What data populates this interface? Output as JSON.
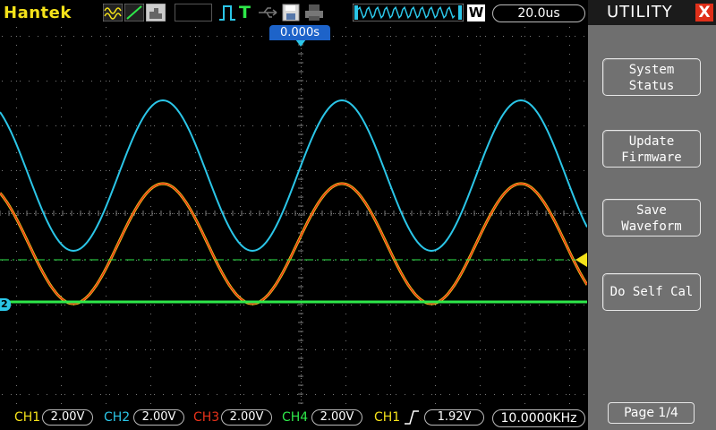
{
  "brand": "Hantek",
  "status": {
    "run_icon": "T",
    "timebase": "20.0us",
    "window_mark": "W"
  },
  "trigger": {
    "delay": "0.000s",
    "channel_marker": "2"
  },
  "menu": {
    "title": "UTILITY",
    "close_icon": "X",
    "buttons": [
      "System Status",
      "Update Firmware",
      "Save Waveform",
      "Do Self Cal"
    ],
    "button_lines": [
      [
        "System",
        "Status"
      ],
      [
        "Update",
        "Firmware"
      ],
      [
        "Save",
        "Waveform"
      ],
      [
        "Do Self Cal"
      ]
    ],
    "page": "Page 1/4"
  },
  "channels": [
    {
      "label": "CH1",
      "scale": "2.00V",
      "color": "#f5e21a"
    },
    {
      "label": "CH2",
      "scale": "2.00V",
      "color": "#2bc6e8"
    },
    {
      "label": "CH3",
      "scale": "2.00V",
      "color": "#e8321a"
    },
    {
      "label": "CH4",
      "scale": "2.00V",
      "color": "#2ee84a"
    }
  ],
  "trigger_info": {
    "source": "CH1",
    "level": "1.92V",
    "frequency": "10.0000KHz"
  },
  "colors": {
    "grid": "#7a7a7a",
    "ch1": "#f5e21a",
    "ch2": "#2bc6e8",
    "ch3": "#e8321a",
    "ch4": "#2ee84a",
    "panel": "#6f6f6f"
  }
}
